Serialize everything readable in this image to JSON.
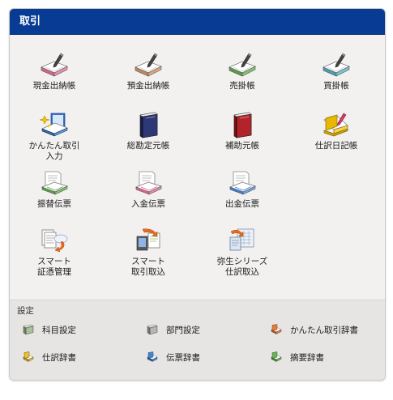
{
  "panel": {
    "title": "取引"
  },
  "tiles": {
    "cash_book": "現金出納帳",
    "deposit_book": "預金出納帳",
    "receivable_book": "売掛帳",
    "payable_book": "買掛帳",
    "easy_entry": "かんたん取引\n入力",
    "general_ledger": "総勘定元帳",
    "sub_ledger": "補助元帳",
    "journal": "仕訳日記帳",
    "transfer_slip": "振替伝票",
    "receipt_slip": "入金伝票",
    "payment_slip": "出金伝票",
    "smart_voucher": "スマート\n証憑管理",
    "smart_import": "スマート\n取引取込",
    "yayoi_import": "弥生シリーズ\n仕訳取込"
  },
  "settings": {
    "title": "設定",
    "account_settings": "科目設定",
    "department_settings": "部門設定",
    "easy_dictionary": "かんたん取引辞書",
    "journal_dictionary": "仕訳辞書",
    "slip_dictionary": "伝票辞書",
    "summary_dictionary": "摘要辞書"
  },
  "colors": {
    "header": "#083b93",
    "panel": "#f2f1f0",
    "settings_bg": "#e6e5e3"
  }
}
